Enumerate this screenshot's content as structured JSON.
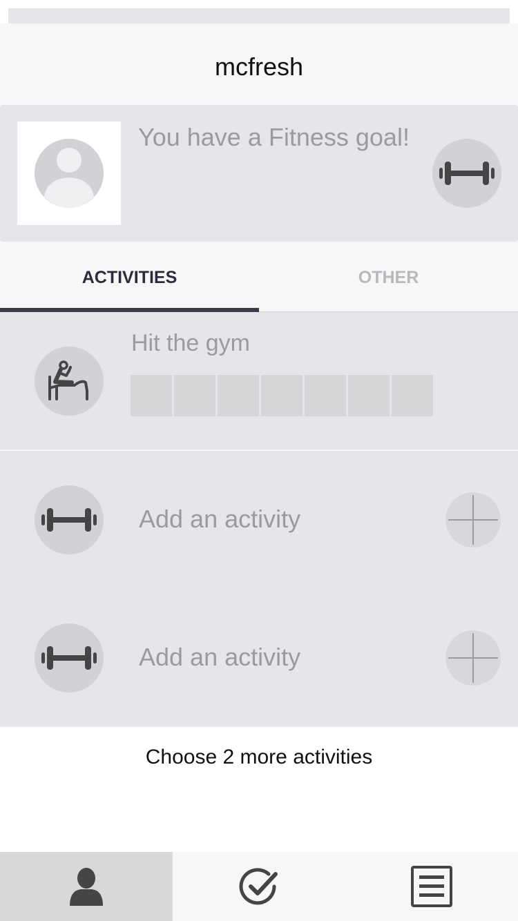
{
  "header": {
    "title": "mcfresh"
  },
  "goal_card": {
    "message": "You have a Fitness goal!",
    "avatar_icon": "user-placeholder-icon",
    "goal_icon": "dumbbell-icon"
  },
  "tabs": [
    {
      "label": "ACTIVITIES",
      "active": true
    },
    {
      "label": "OTHER",
      "active": false
    }
  ],
  "activities": [
    {
      "title": "Hit the gym",
      "icon": "gym-bench-icon",
      "progress_cells_total": 7,
      "progress_cells_filled": 0
    },
    {
      "title": "Add an activity",
      "icon": "dumbbell-icon",
      "action_icon": "plus-icon"
    },
    {
      "title": "Add an activity",
      "icon": "dumbbell-icon",
      "action_icon": "plus-icon"
    }
  ],
  "footer": {
    "message": "Choose 2 more activities"
  },
  "tabbar": [
    {
      "icon": "person-icon",
      "selected": true
    },
    {
      "icon": "checkmark-circle-icon",
      "selected": false
    },
    {
      "icon": "list-icon",
      "selected": false
    }
  ],
  "colors": {
    "background": "#e6e6ea",
    "tab_active": "#2c2c3c",
    "tab_inactive": "#b9b9bd",
    "muted_text": "#9b9b9b",
    "icon_dark": "#454545"
  }
}
